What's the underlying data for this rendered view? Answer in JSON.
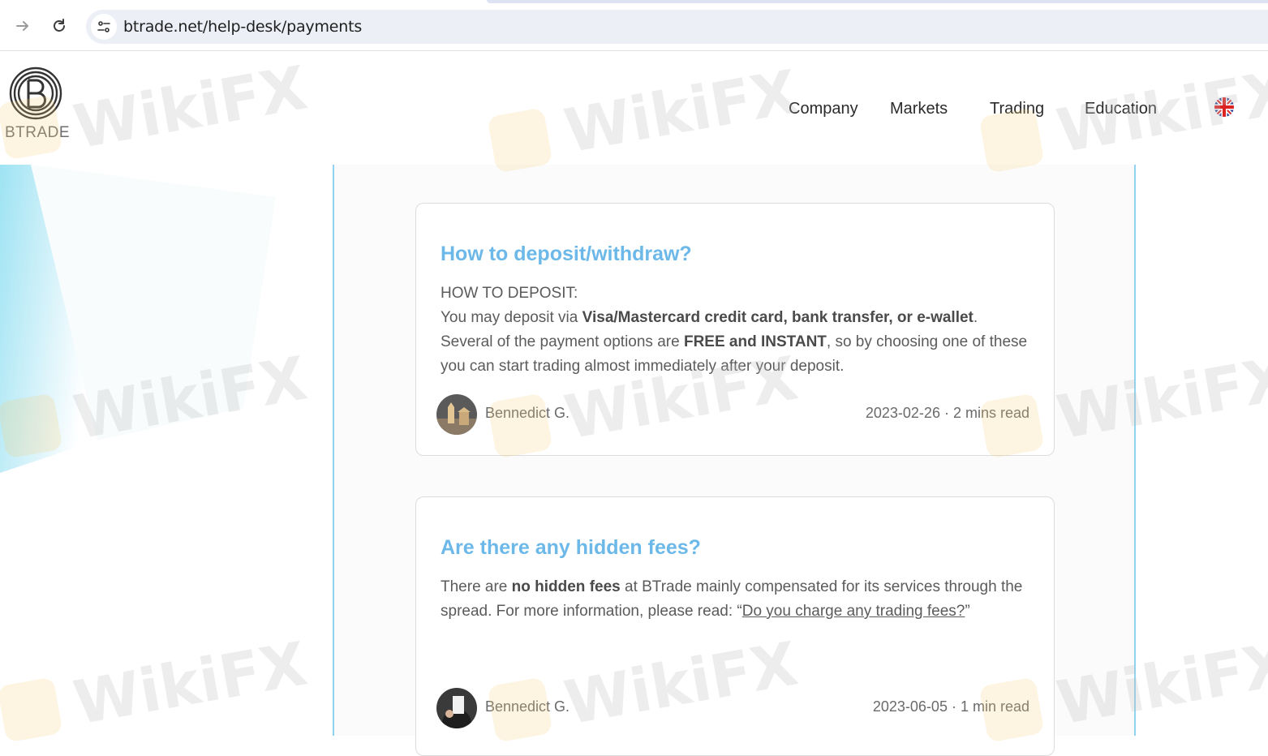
{
  "browser": {
    "url": "btrade.net/help-desk/payments"
  },
  "site": {
    "logo_text": "BTRADE",
    "nav": [
      "Company",
      "Markets",
      "Trading",
      "Education"
    ],
    "language_flag": "uk-flag-icon"
  },
  "watermark": {
    "text": "WikiFX"
  },
  "articles": [
    {
      "title": "How to deposit/withdraw?",
      "heading": "HOW TO DEPOSIT:",
      "p1_prefix": "You may deposit via ",
      "p1_bold": "Visa/Mastercard credit card, bank transfer, or e-wallet",
      "p1_suffix": ".",
      "p2_prefix": "Several of the payment options are ",
      "p2_bold": "FREE and INSTANT",
      "p2_suffix": ", so by choosing one of these you can start trading almost immediately after your deposit.",
      "author": "Bennedict G.",
      "date": "2023-02-26",
      "read_time": "2 mins read"
    },
    {
      "title": "Are there any hidden fees?",
      "p1_prefix": "There are ",
      "p1_bold": "no hidden fees",
      "p1_mid": " at BTrade mainly compensated for its services through the spread. For more information, please read: “",
      "p1_link": "Do you charge any trading fees?",
      "p1_suffix": "”",
      "author": "Bennedict G.",
      "date": "2023-06-05",
      "read_time": "1 min read"
    }
  ],
  "meta_separator": " · ",
  "colors": {
    "title_blue": "#6cb8e8",
    "border_blue": "#8fd3f0",
    "deco_cyan": "#9ee3f3"
  }
}
